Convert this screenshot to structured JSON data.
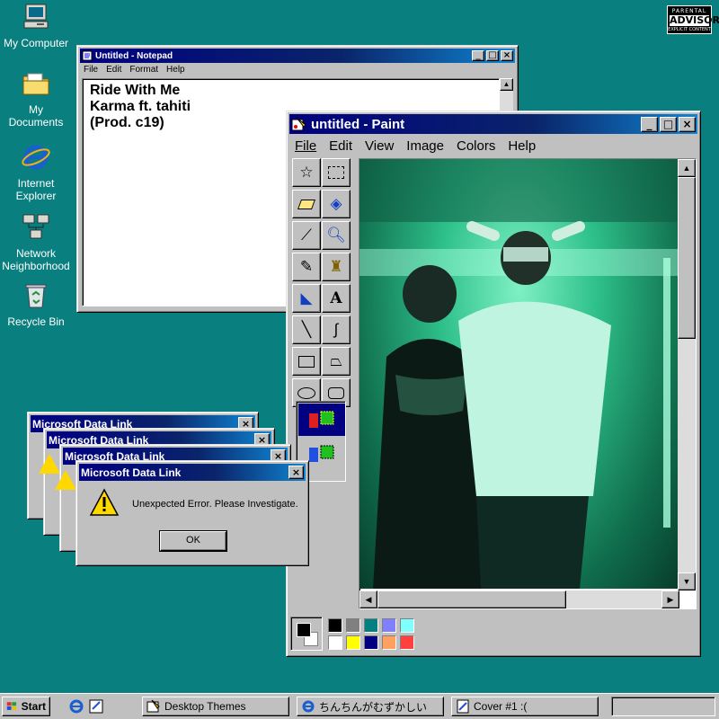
{
  "desktop_icons": [
    {
      "label": "My Computer",
      "icon": "my-computer-icon"
    },
    {
      "label": "My Documents",
      "icon": "folder-icon"
    },
    {
      "label": "Internet Explorer",
      "icon": "internet-explorer-icon"
    },
    {
      "label": "Network Neighborhood",
      "icon": "network-icon"
    },
    {
      "label": "Recycle Bin",
      "icon": "recycle-bin-icon"
    }
  ],
  "advisory": {
    "line1": "PARENTAL",
    "line2": "ADVISORY",
    "line3": "EXPLICIT CONTENT"
  },
  "notepad": {
    "title": "Untitled - Notepad",
    "menu": [
      "File",
      "Edit",
      "Format",
      "Help"
    ],
    "lines": [
      "Ride With Me",
      "Karma ft. tahiti",
      "(Prod. c19)"
    ]
  },
  "paint": {
    "title": "untitled - Paint",
    "menu": [
      "File",
      "Edit",
      "View",
      "Image",
      "Colors",
      "Help"
    ],
    "palette": [
      "#000000",
      "#808080",
      "#008080",
      "#8080ff",
      "#80ffff",
      "#ffffff",
      "#ffff00",
      "#000080",
      "#ffa060",
      "#ff4040"
    ]
  },
  "dialogs": {
    "title": "Microsoft Data Link",
    "message": "Unexpected Error. Please Investigate.",
    "ok_label": "OK"
  },
  "taskbar": {
    "start_label": "Start",
    "tasks": [
      "Desktop Themes",
      "ちんちんがむずかしい",
      "Cover #1 :("
    ]
  }
}
